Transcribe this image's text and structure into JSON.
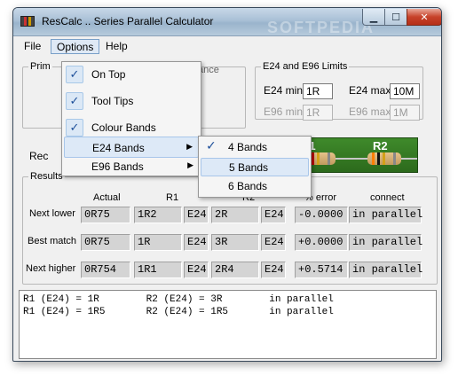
{
  "window": {
    "title": "ResCalc .. Series Parallel Calculator",
    "watermark": "SOFTPEDIA"
  },
  "menubar": {
    "file": "File",
    "options": "Options",
    "help": "Help"
  },
  "groups": {
    "primary_partial": "Prim",
    "tolerance_partial": "ance",
    "limits_title": "E24 and E96 Limits",
    "required_partial": "Rec",
    "results_title": "Results"
  },
  "limits": {
    "e24_min_label": "E24 min",
    "e24_min_value": "1R",
    "e24_max_label": "E24 max",
    "e24_max_value": "10M",
    "e96_min_label": "E96 min",
    "e96_min_value": "1R",
    "e96_max_label": "E96 max",
    "e96_max_value": "1M"
  },
  "resistor_panel": {
    "r1": "R1",
    "r2": "R2"
  },
  "results": {
    "headers": {
      "actual": "Actual",
      "r1": "R1",
      "r2": "R2",
      "error": "% error",
      "connect": "connect"
    },
    "rows": [
      {
        "label": "Next lower",
        "actual": "0R75",
        "r1": "1R2",
        "r1s": "E24",
        "r2": "2R",
        "r2s": "E24",
        "error": "-0.0000",
        "connect": "in parallel"
      },
      {
        "label": "Best match",
        "actual": "0R75",
        "r1": "1R",
        "r1s": "E24",
        "r2": "3R",
        "r2s": "E24",
        "error": "+0.0000",
        "connect": "in parallel"
      },
      {
        "label": "Next higher",
        "actual": "0R754",
        "r1": "1R1",
        "r1s": "E24",
        "r2": "2R4",
        "r2s": "E24",
        "error": "+0.5714",
        "connect": "in parallel"
      }
    ]
  },
  "output_lines": [
    "R1 (E24) = 1R        R2 (E24) = 3R        in parallel",
    "R1 (E24) = 1R5       R2 (E24) = 1R5       in parallel"
  ],
  "options_menu": {
    "on_top": "On Top",
    "tool_tips": "Tool Tips",
    "colour_bands": "Colour Bands",
    "e24_bands": "E24 Bands",
    "e96_bands": "E96 Bands",
    "check_mark": "✓",
    "submenu_arrow": "▶"
  },
  "bands_submenu": {
    "four": "4 Bands",
    "five": "5 Bands",
    "six": "6 Bands"
  }
}
